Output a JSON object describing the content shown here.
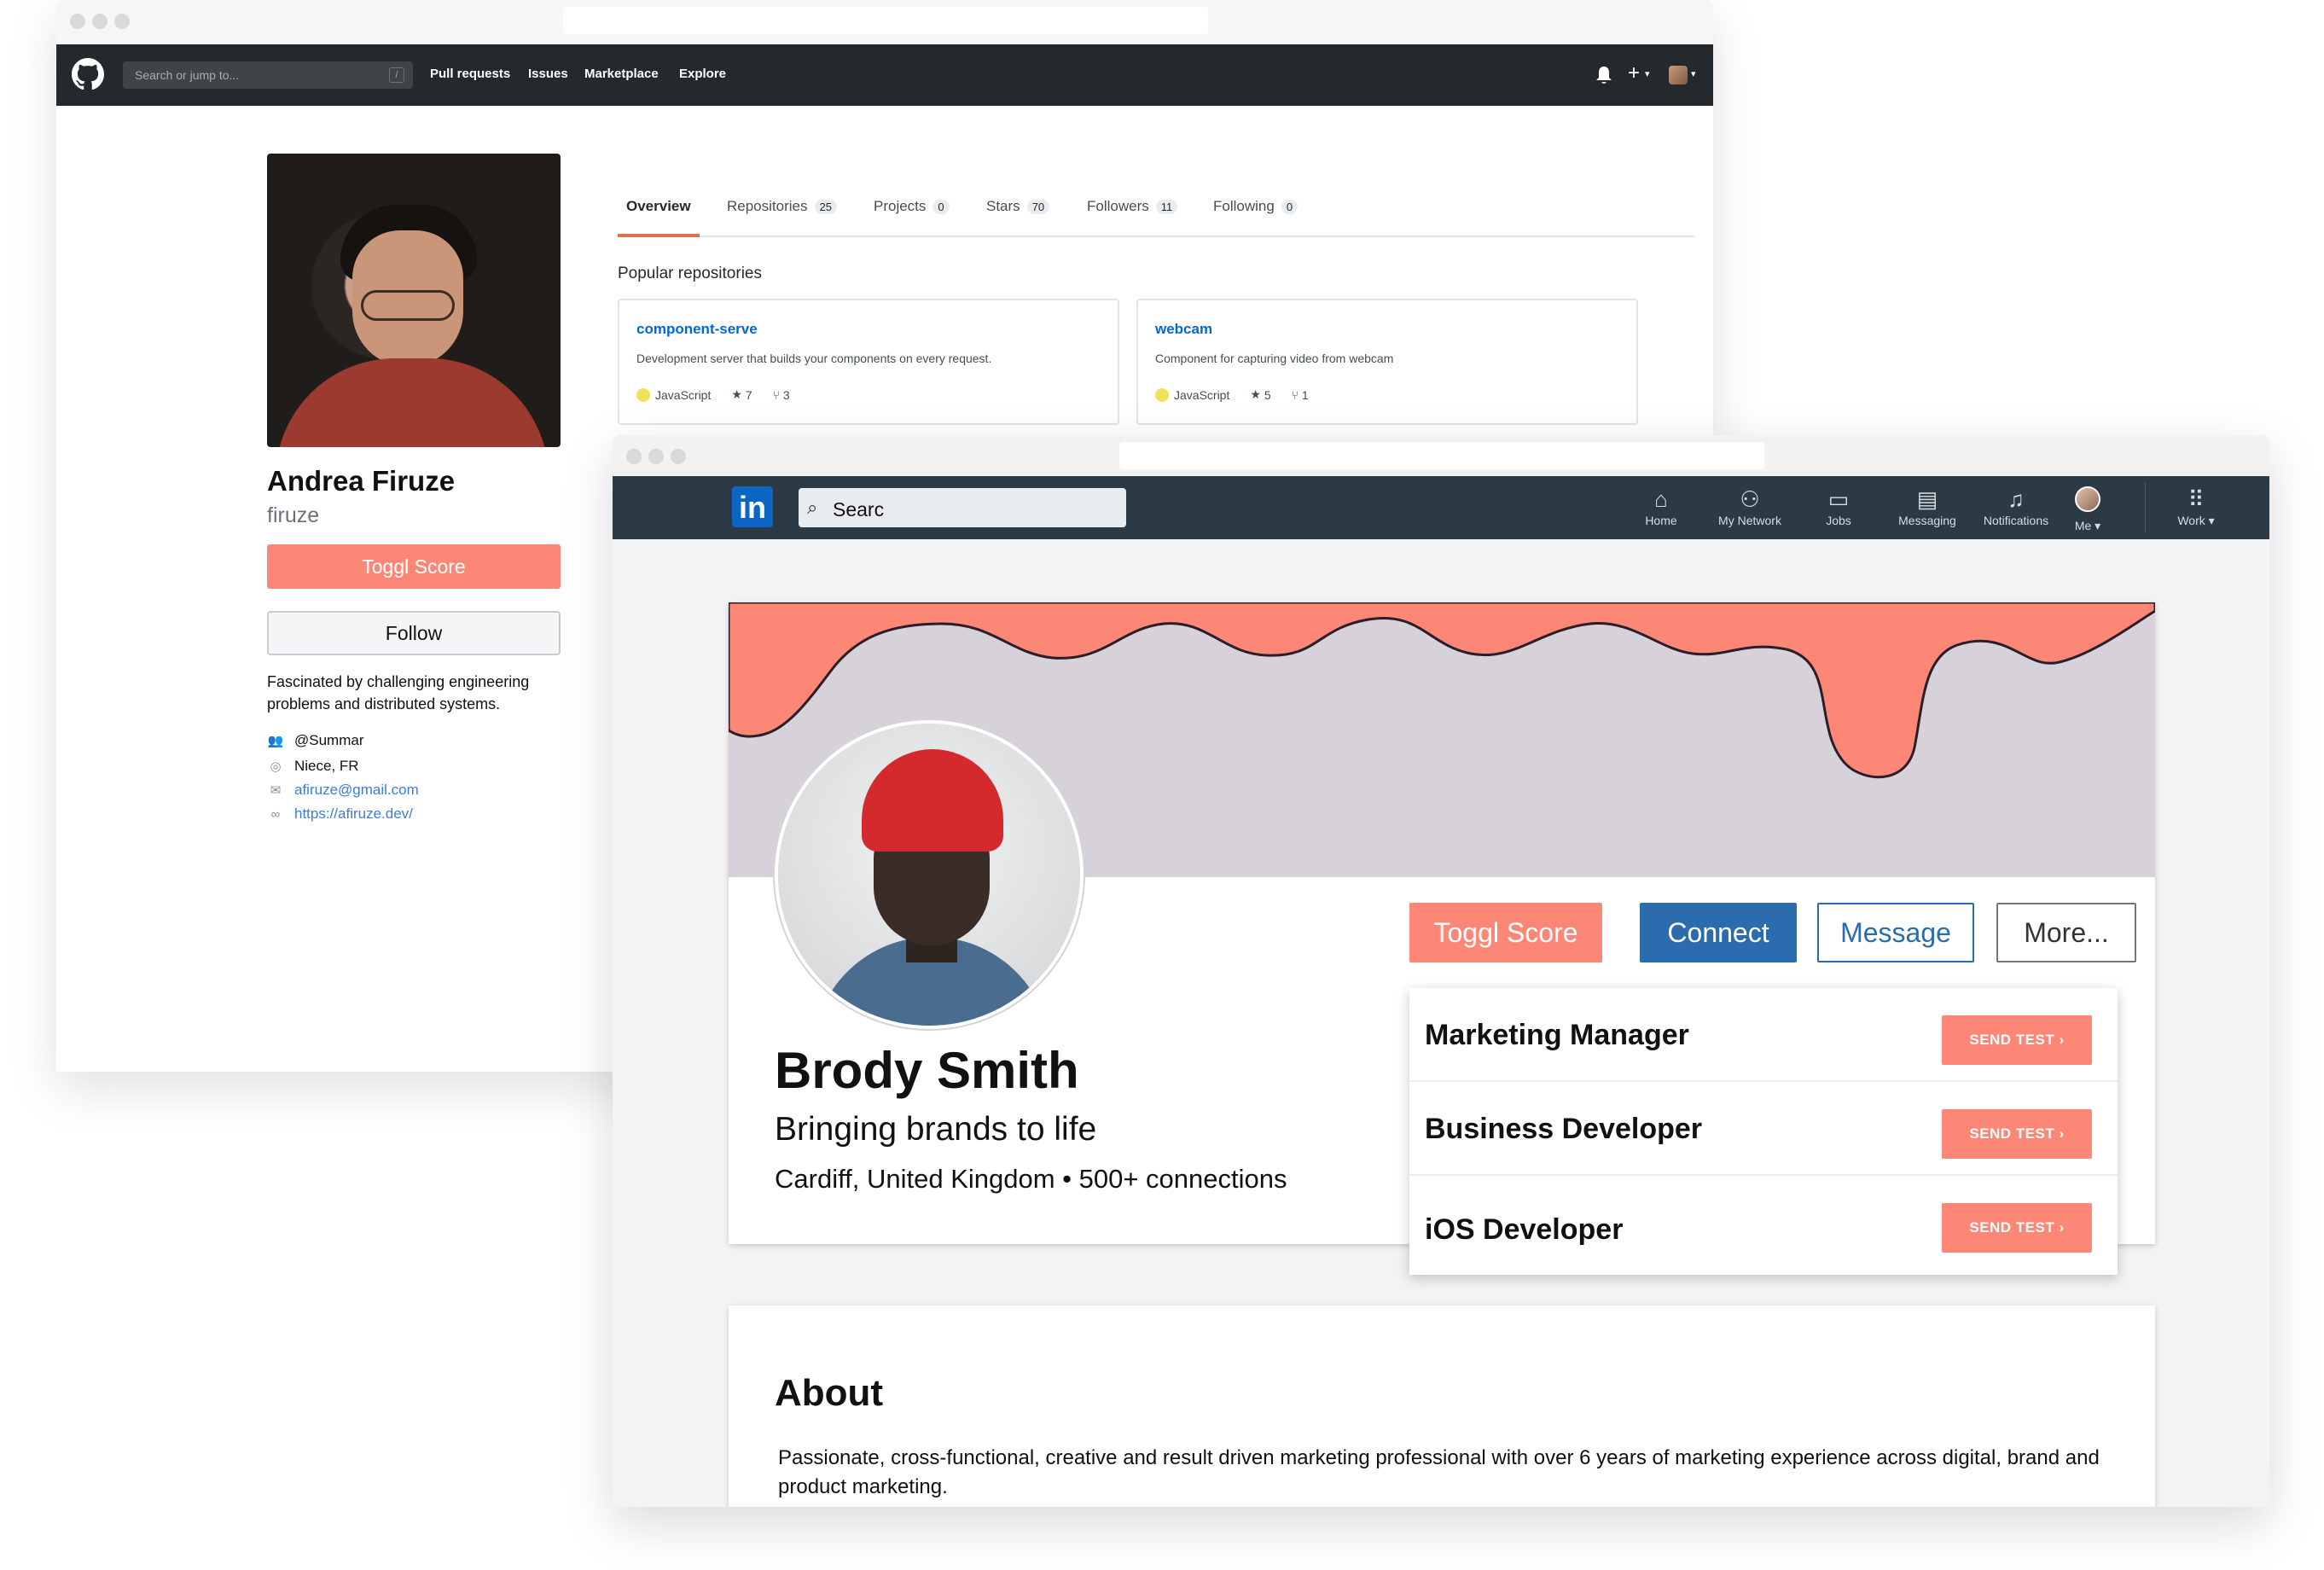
{
  "github": {
    "search_placeholder": "Search or jump to...",
    "search_key": "/",
    "nav_links": [
      "Pull requests",
      "Issues",
      "Marketplace",
      "Explore"
    ],
    "plus_label": "+",
    "profile": {
      "name": "Andrea Firuze",
      "login": "firuze",
      "toggl_label": "Toggl Score",
      "follow_label": "Follow",
      "bio": "Fascinated by challenging engineering problems and distributed systems.",
      "org": "@Summar",
      "location": "Niece, FR",
      "email": "afiruze@gmail.com",
      "website": "https://afiruze.dev/"
    },
    "tabs": [
      {
        "label": "Overview",
        "count": ""
      },
      {
        "label": "Repositories",
        "count": "25"
      },
      {
        "label": "Projects",
        "count": "0"
      },
      {
        "label": "Stars",
        "count": "70"
      },
      {
        "label": "Followers",
        "count": "11"
      },
      {
        "label": "Following",
        "count": "0"
      }
    ],
    "popular_title": "Popular repositories",
    "repos": [
      {
        "name": "component-serve",
        "description": "Development server that builds your components on every request.",
        "language": "JavaScript",
        "stars": "7",
        "forks": "3"
      },
      {
        "name": "webcam",
        "description": "Component for capturing video from webcam",
        "language": "JavaScript",
        "stars": "5",
        "forks": "1"
      }
    ]
  },
  "linkedin": {
    "logo_text": "in",
    "search_value": "Searc",
    "nav": [
      {
        "label": "Home",
        "icon": "home-icon"
      },
      {
        "label": "My Network",
        "icon": "network-icon"
      },
      {
        "label": "Jobs",
        "icon": "briefcase-icon"
      },
      {
        "label": "Messaging",
        "icon": "messaging-icon"
      },
      {
        "label": "Notifications",
        "icon": "bell-icon"
      },
      {
        "label": "Me",
        "icon": "avatar"
      },
      {
        "label": "Work",
        "icon": "grid-icon"
      }
    ],
    "profile": {
      "name": "Brody Smith",
      "headline": "Bringing brands to life",
      "location": "Cardiff, United Kingdom • 500+ connections"
    },
    "buttons": {
      "toggl": "Toggl Score",
      "connect": "Connect",
      "message": "Message",
      "more": "More..."
    },
    "jobs": [
      {
        "title": "Marketing Manager",
        "action": "SEND TEST ›"
      },
      {
        "title": "Business Developer",
        "action": "SEND TEST ›"
      },
      {
        "title": "iOS Developer",
        "action": "SEND TEST ›"
      }
    ],
    "about": {
      "heading": "About",
      "text": "Passionate, cross-functional, creative and result driven marketing professional with over 6 years of marketing experience across digital, brand and product marketing."
    }
  },
  "colors": {
    "toggl": "#fd8776",
    "github_nav": "#24292e",
    "linkedin_nav": "#2b3a45",
    "linkedin_blue": "#2a6cad",
    "banner_lilac": "#d7d2da"
  }
}
